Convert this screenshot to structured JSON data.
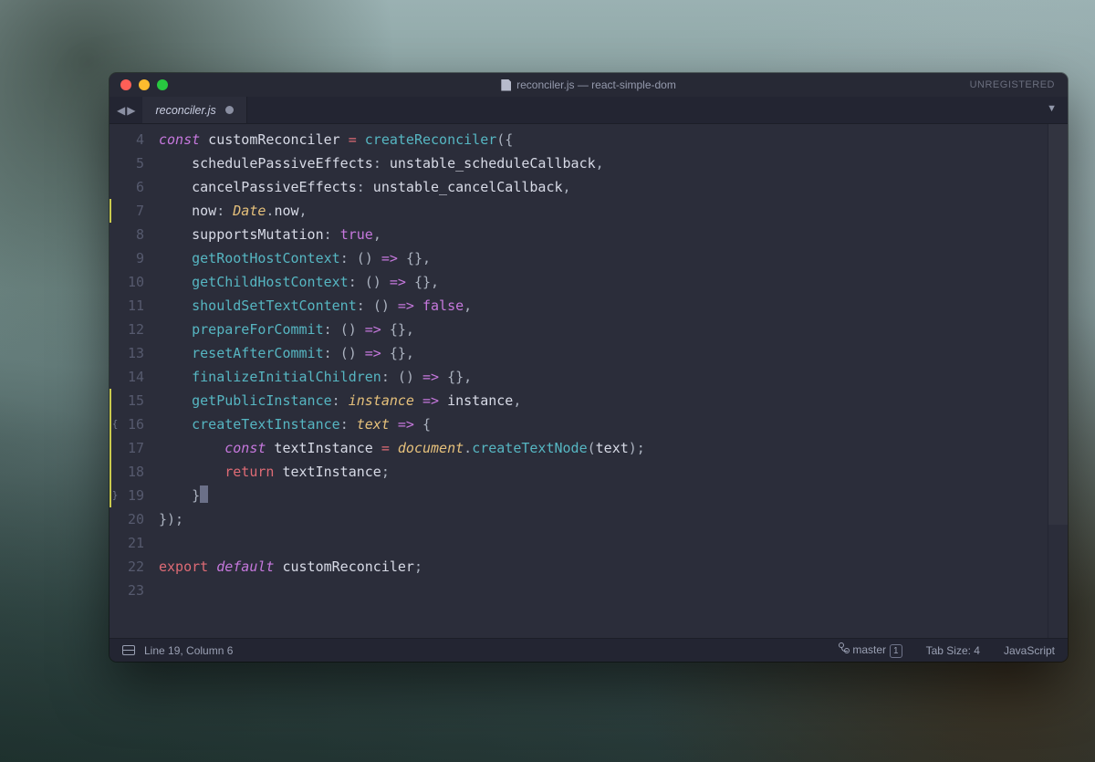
{
  "window": {
    "title": "reconciler.js — react-simple-dom",
    "unregistered": "UNREGISTERED"
  },
  "tab": {
    "filename": "reconciler.js"
  },
  "code_lines": [
    {
      "n": 4,
      "mod": false,
      "fold": "",
      "tokens": [
        [
          "kw",
          "const"
        ],
        [
          "ident",
          " customReconciler "
        ],
        [
          "op",
          "="
        ],
        [
          "ident",
          " "
        ],
        [
          "fn",
          "createReconciler"
        ],
        [
          "punct",
          "({"
        ]
      ]
    },
    {
      "n": 5,
      "mod": false,
      "fold": "",
      "tokens": [
        [
          "ident",
          "    schedulePassiveEffects"
        ],
        [
          "punct",
          ":"
        ],
        [
          "ident",
          " unstable_scheduleCallback"
        ],
        [
          "punct",
          ","
        ]
      ]
    },
    {
      "n": 6,
      "mod": false,
      "fold": "",
      "tokens": [
        [
          "ident",
          "    cancelPassiveEffects"
        ],
        [
          "punct",
          ":"
        ],
        [
          "ident",
          " unstable_cancelCallback"
        ],
        [
          "punct",
          ","
        ]
      ]
    },
    {
      "n": 7,
      "mod": true,
      "fold": "",
      "tokens": [
        [
          "ident",
          "    now"
        ],
        [
          "punct",
          ":"
        ],
        [
          "ident",
          " "
        ],
        [
          "builtin",
          "Date"
        ],
        [
          "punct",
          "."
        ],
        [
          "ident",
          "now"
        ],
        [
          "punct",
          ","
        ]
      ]
    },
    {
      "n": 8,
      "mod": false,
      "fold": "",
      "tokens": [
        [
          "ident",
          "    supportsMutation"
        ],
        [
          "punct",
          ":"
        ],
        [
          "ident",
          " "
        ],
        [
          "bool",
          "true"
        ],
        [
          "punct",
          ","
        ]
      ]
    },
    {
      "n": 9,
      "mod": false,
      "fold": "",
      "tokens": [
        [
          "ident",
          "    "
        ],
        [
          "prop-green",
          "getRootHostContext"
        ],
        [
          "punct",
          ":"
        ],
        [
          "ident",
          " "
        ],
        [
          "punct",
          "()"
        ],
        [
          "ident",
          " "
        ],
        [
          "kw",
          "=>"
        ],
        [
          "ident",
          " "
        ],
        [
          "punct",
          "{},"
        ]
      ]
    },
    {
      "n": 10,
      "mod": false,
      "fold": "",
      "tokens": [
        [
          "ident",
          "    "
        ],
        [
          "prop-green",
          "getChildHostContext"
        ],
        [
          "punct",
          ":"
        ],
        [
          "ident",
          " "
        ],
        [
          "punct",
          "()"
        ],
        [
          "ident",
          " "
        ],
        [
          "kw",
          "=>"
        ],
        [
          "ident",
          " "
        ],
        [
          "punct",
          "{},"
        ]
      ]
    },
    {
      "n": 11,
      "mod": false,
      "fold": "",
      "tokens": [
        [
          "ident",
          "    "
        ],
        [
          "prop-green",
          "shouldSetTextContent"
        ],
        [
          "punct",
          ":"
        ],
        [
          "ident",
          " "
        ],
        [
          "punct",
          "()"
        ],
        [
          "ident",
          " "
        ],
        [
          "kw",
          "=>"
        ],
        [
          "ident",
          " "
        ],
        [
          "bool",
          "false"
        ],
        [
          "punct",
          ","
        ]
      ]
    },
    {
      "n": 12,
      "mod": false,
      "fold": "",
      "tokens": [
        [
          "ident",
          "    "
        ],
        [
          "prop-green",
          "prepareForCommit"
        ],
        [
          "punct",
          ":"
        ],
        [
          "ident",
          " "
        ],
        [
          "punct",
          "()"
        ],
        [
          "ident",
          " "
        ],
        [
          "kw",
          "=>"
        ],
        [
          "ident",
          " "
        ],
        [
          "punct",
          "{},"
        ]
      ]
    },
    {
      "n": 13,
      "mod": false,
      "fold": "",
      "tokens": [
        [
          "ident",
          "    "
        ],
        [
          "prop-green",
          "resetAfterCommit"
        ],
        [
          "punct",
          ":"
        ],
        [
          "ident",
          " "
        ],
        [
          "punct",
          "()"
        ],
        [
          "ident",
          " "
        ],
        [
          "kw",
          "=>"
        ],
        [
          "ident",
          " "
        ],
        [
          "punct",
          "{},"
        ]
      ]
    },
    {
      "n": 14,
      "mod": false,
      "fold": "",
      "tokens": [
        [
          "ident",
          "    "
        ],
        [
          "prop-green",
          "finalizeInitialChildren"
        ],
        [
          "punct",
          ":"
        ],
        [
          "ident",
          " "
        ],
        [
          "punct",
          "()"
        ],
        [
          "ident",
          " "
        ],
        [
          "kw",
          "=>"
        ],
        [
          "ident",
          " "
        ],
        [
          "punct",
          "{},"
        ]
      ]
    },
    {
      "n": 15,
      "mod": true,
      "fold": "",
      "tokens": [
        [
          "ident",
          "    "
        ],
        [
          "prop-green",
          "getPublicInstance"
        ],
        [
          "punct",
          ":"
        ],
        [
          "ident",
          " "
        ],
        [
          "param",
          "instance"
        ],
        [
          "ident",
          " "
        ],
        [
          "kw",
          "=>"
        ],
        [
          "ident",
          " instance"
        ],
        [
          "punct",
          ","
        ]
      ]
    },
    {
      "n": 16,
      "mod": true,
      "fold": "{",
      "tokens": [
        [
          "ident",
          "    "
        ],
        [
          "prop-green",
          "createTextInstance"
        ],
        [
          "punct",
          ":"
        ],
        [
          "ident",
          " "
        ],
        [
          "param",
          "text"
        ],
        [
          "ident",
          " "
        ],
        [
          "kw",
          "=>"
        ],
        [
          "ident",
          " "
        ],
        [
          "punct",
          "{"
        ]
      ]
    },
    {
      "n": 17,
      "mod": true,
      "fold": "",
      "tokens": [
        [
          "ident",
          "        "
        ],
        [
          "kw",
          "const"
        ],
        [
          "ident",
          " textInstance "
        ],
        [
          "op",
          "="
        ],
        [
          "ident",
          " "
        ],
        [
          "builtin",
          "document"
        ],
        [
          "punct",
          "."
        ],
        [
          "fn",
          "createTextNode"
        ],
        [
          "punct",
          "("
        ],
        [
          "ident",
          "text"
        ],
        [
          "punct",
          ");"
        ]
      ]
    },
    {
      "n": 18,
      "mod": true,
      "fold": "",
      "tokens": [
        [
          "ident",
          "        "
        ],
        [
          "ret",
          "return"
        ],
        [
          "ident",
          " textInstance"
        ],
        [
          "punct",
          ";"
        ]
      ]
    },
    {
      "n": 19,
      "mod": true,
      "fold": "}",
      "tokens": [
        [
          "ident",
          "    "
        ],
        [
          "punct",
          "}"
        ],
        [
          "cursor",
          ""
        ]
      ]
    },
    {
      "n": 20,
      "mod": false,
      "fold": "",
      "tokens": [
        [
          "punct",
          "});"
        ]
      ]
    },
    {
      "n": 21,
      "mod": false,
      "fold": "",
      "tokens": [
        [
          "ident",
          ""
        ]
      ]
    },
    {
      "n": 22,
      "mod": false,
      "fold": "",
      "tokens": [
        [
          "ret",
          "export"
        ],
        [
          "ident",
          " "
        ],
        [
          "kw",
          "default"
        ],
        [
          "ident",
          " customReconciler"
        ],
        [
          "punct",
          ";"
        ]
      ]
    },
    {
      "n": 23,
      "mod": false,
      "fold": "",
      "tokens": [
        [
          "ident",
          ""
        ]
      ]
    }
  ],
  "status": {
    "cursor": "Line 19, Column 6",
    "branch": "master",
    "branch_count": "1",
    "tab_size": "Tab Size: 4",
    "lang": "JavaScript"
  }
}
